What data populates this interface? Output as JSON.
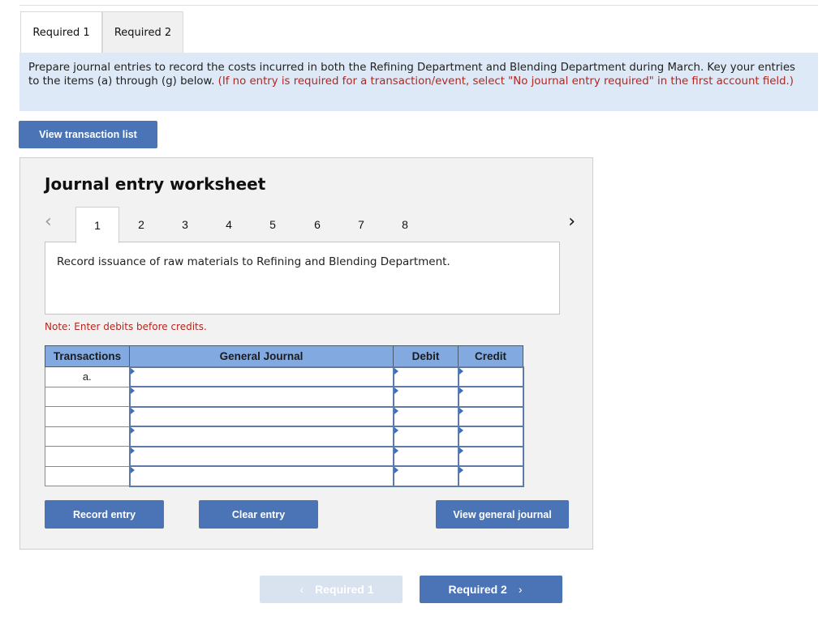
{
  "tabs": [
    {
      "label": "Required 1",
      "active": true
    },
    {
      "label": "Required 2",
      "active": false
    }
  ],
  "instructions": {
    "main": "Prepare journal entries to record the costs incurred in both the Refining Department and Blending Department during March. Key your entries to the items (a) through (g) below. ",
    "note": "(If no entry is required for a transaction/event, select \"No journal entry required\" in the first account field.)"
  },
  "view_transaction_list": "View transaction list",
  "worksheet": {
    "title": "Journal entry worksheet",
    "prev_icon": "chevron-left-icon",
    "next_icon": "chevron-right-icon",
    "pages": [
      "1",
      "2",
      "3",
      "4",
      "5",
      "6",
      "7",
      "8"
    ],
    "active_page": "1",
    "description": "Record issuance of raw materials to Refining and Blending Department.",
    "note": "Note: Enter debits before credits.",
    "table": {
      "headers": {
        "transactions": "Transactions",
        "general_journal": "General Journal",
        "debit": "Debit",
        "credit": "Credit"
      },
      "rows": [
        {
          "transaction": "a.",
          "account": "",
          "debit": "",
          "credit": ""
        },
        {
          "transaction": "",
          "account": "",
          "debit": "",
          "credit": ""
        },
        {
          "transaction": "",
          "account": "",
          "debit": "",
          "credit": ""
        },
        {
          "transaction": "",
          "account": "",
          "debit": "",
          "credit": ""
        },
        {
          "transaction": "",
          "account": "",
          "debit": "",
          "credit": ""
        },
        {
          "transaction": "",
          "account": "",
          "debit": "",
          "credit": ""
        }
      ]
    },
    "buttons": {
      "record": "Record entry",
      "clear": "Clear entry",
      "view_general_journal": "View general journal"
    }
  },
  "footer": {
    "prev_label": "Required 1",
    "prev_disabled": true,
    "next_label": "Required 2",
    "prev_chevron": "‹",
    "next_chevron": "›"
  },
  "colors": {
    "accent": "#4a74b5",
    "header_blue": "#82aae0",
    "instruction_bg": "#dde9f7",
    "warning_red": "#b5261e"
  }
}
